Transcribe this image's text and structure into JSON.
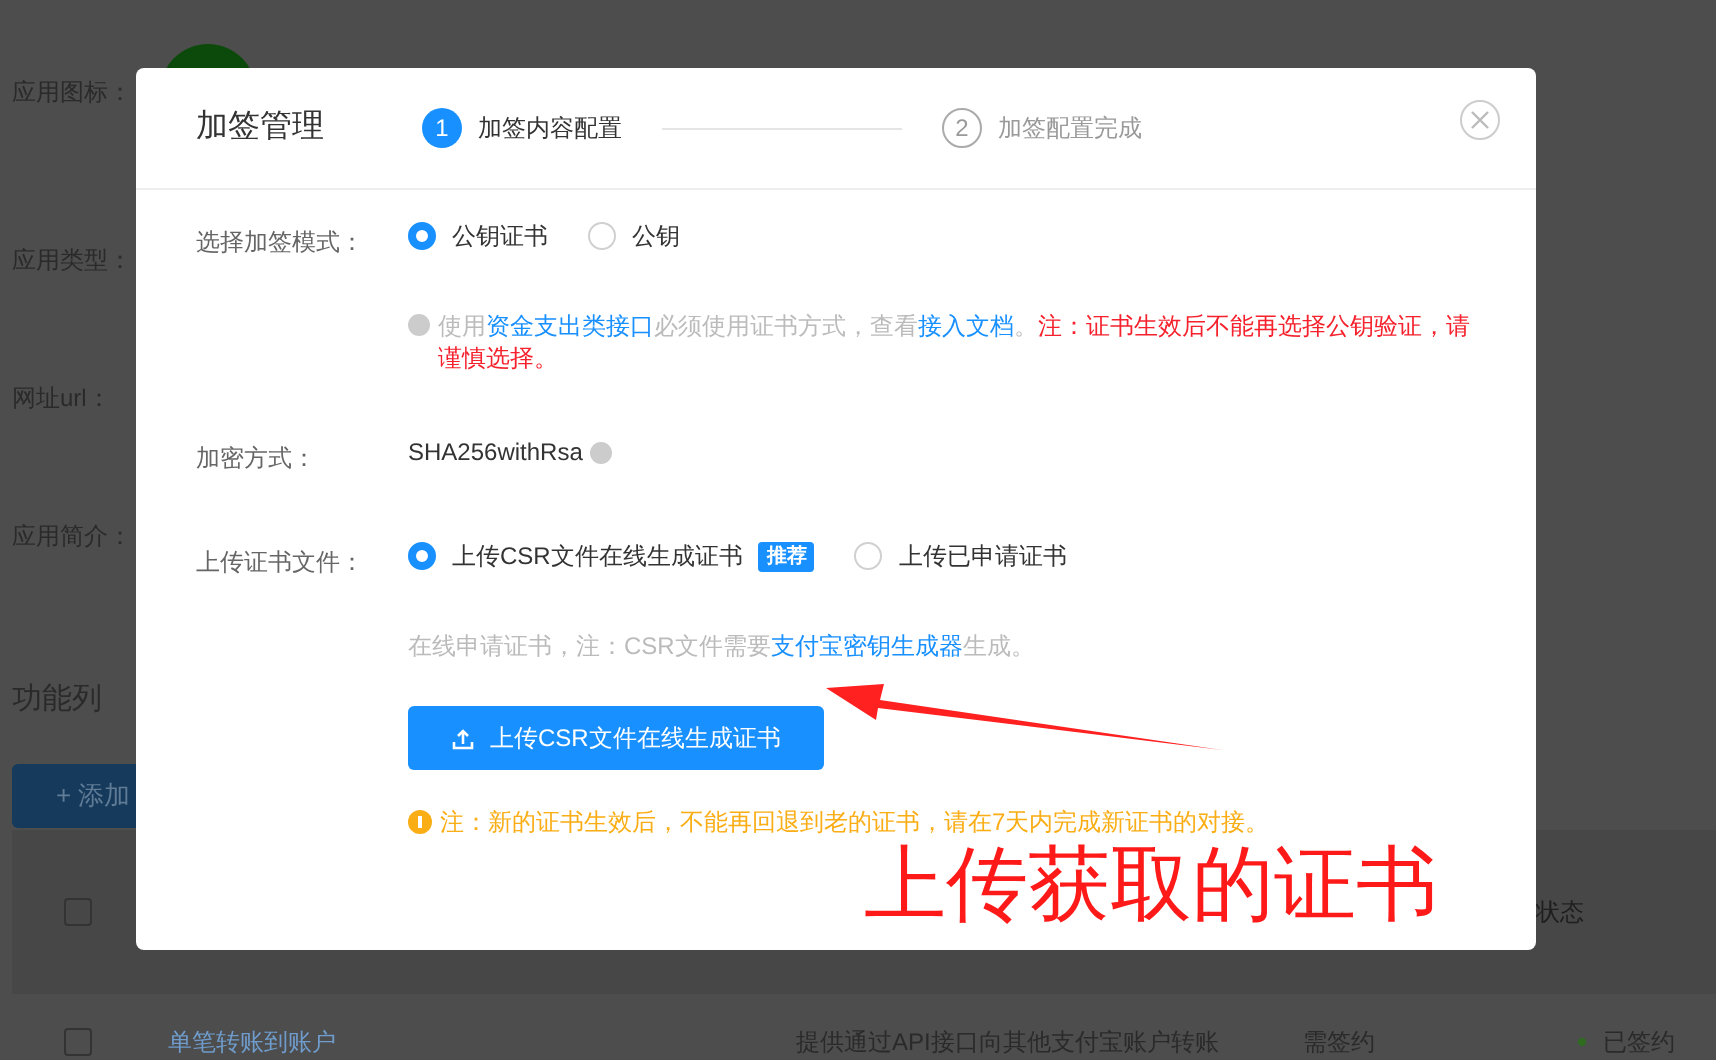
{
  "background": {
    "form_labels": [
      "应用图标：",
      "应用类型：",
      "网址url：",
      "应用简介："
    ],
    "section_title": "功能列",
    "add_button": "+ 添加",
    "table": {
      "header": {
        "checked": false,
        "status": "状态"
      },
      "row": {
        "checked": false,
        "name": "单笔转账到账户",
        "description": "提供通过API接口向其他支付宝账户转账",
        "requirement": "需签约",
        "status": "已签约",
        "color": "#2e6b1e"
      }
    }
  },
  "dialog": {
    "title": "加签管理",
    "steps": [
      {
        "number": "1",
        "label": "加签内容配置",
        "selected": true
      },
      {
        "number": "2",
        "label": "加签配置完成",
        "selected": false
      }
    ],
    "fields": [
      {
        "kind": "radio",
        "label": "选择加签模式：",
        "options": [
          {
            "label": "公钥证书",
            "selected": true
          },
          {
            "label": "公钥",
            "selected": false
          }
        ]
      },
      {
        "kind": "info-note",
        "parts": [
          {
            "kind": "muted",
            "text": "使用"
          },
          {
            "kind": "link",
            "text": "资金支出类接口"
          },
          {
            "kind": "muted",
            "text": "必须使用证书方式，查看"
          },
          {
            "kind": "link",
            "text": "接入文档"
          },
          {
            "kind": "muted",
            "text": "。"
          },
          {
            "kind": "danger",
            "text": "注：证书生效后不能再选择公钥验证，请谨慎选择。"
          }
        ]
      },
      {
        "kind": "value",
        "label": "加密方式：",
        "value": "SHA256withRsa"
      },
      {
        "kind": "radio",
        "label": "上传证书文件：",
        "options": [
          {
            "label": "上传CSR文件在线生成证书",
            "selected": true,
            "badge": "推荐"
          },
          {
            "label": "上传已申请证书",
            "selected": false
          }
        ]
      },
      {
        "kind": "note",
        "parts": [
          {
            "kind": "muted",
            "text": "在线申请证书，注：CSR文件需要"
          },
          {
            "kind": "link",
            "text": "支付宝密钥生成器"
          },
          {
            "kind": "muted",
            "text": "生成。"
          }
        ]
      },
      {
        "kind": "button",
        "label": "上传CSR文件在线生成证书"
      },
      {
        "kind": "warning-note",
        "parts": [
          {
            "kind": "warning",
            "text": "注：新的证书生效后，不能再回退到老的证书，请在7天内完成新证书的对接。"
          }
        ]
      }
    ]
  },
  "annotation": {
    "text": "上传获取的证书"
  }
}
